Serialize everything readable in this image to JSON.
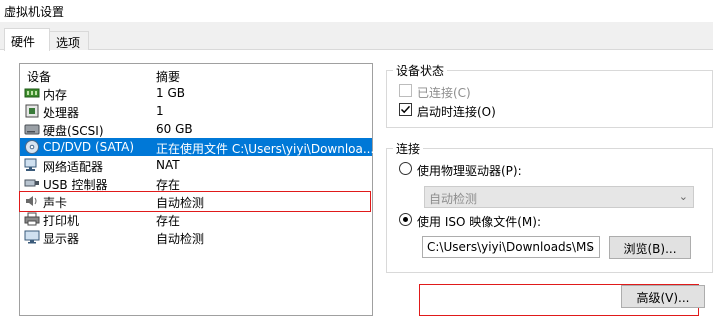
{
  "window": {
    "title": "虚拟机设置"
  },
  "tabs": [
    {
      "label": "硬件",
      "active": true
    },
    {
      "label": "选项",
      "active": false
    }
  ],
  "device_list": {
    "headers": {
      "device": "设备",
      "summary": "摘要"
    },
    "rows": [
      {
        "name": "内存",
        "summary": "1 GB",
        "icon": "memory-icon",
        "selected": false
      },
      {
        "name": "处理器",
        "summary": "1",
        "icon": "processor-icon",
        "selected": false
      },
      {
        "name": "硬盘(SCSI)",
        "summary": "60 GB",
        "icon": "hard-disk-icon",
        "selected": false
      },
      {
        "name": "CD/DVD (SATA)",
        "summary": "正在使用文件 C:\\Users\\yiyi\\Downloa...",
        "icon": "cd-dvd-icon",
        "selected": true
      },
      {
        "name": "网络适配器",
        "summary": "NAT",
        "icon": "network-adapter-icon",
        "selected": false
      },
      {
        "name": "USB 控制器",
        "summary": "存在",
        "icon": "usb-icon",
        "selected": false
      },
      {
        "name": "声卡",
        "summary": "自动检测",
        "icon": "sound-card-icon",
        "selected": false
      },
      {
        "name": "打印机",
        "summary": "存在",
        "icon": "printer-icon",
        "selected": false
      },
      {
        "name": "显示器",
        "summary": "自动检测",
        "icon": "display-icon",
        "selected": false
      }
    ]
  },
  "device_status": {
    "label": "设备状态",
    "connected": {
      "label": "已连接(C)",
      "checked": false,
      "enabled": false
    },
    "connect_at_power_on": {
      "label": "启动时连接(O)",
      "checked": true,
      "enabled": true
    }
  },
  "connection": {
    "label": "连接",
    "physical_drive": {
      "label": "使用物理驱动器(P):",
      "selected": false
    },
    "physical_drive_select": {
      "value": "自动检测",
      "enabled": false
    },
    "iso_image": {
      "label": "使用 ISO 映像文件(M):",
      "selected": true
    },
    "iso_path": {
      "value": "C:\\Users\\yiyi\\Downloads\\MS"
    },
    "browse_button": "浏览(B)...",
    "advanced_button": "高级(V)..."
  },
  "colors": {
    "selection": "#0078d7",
    "highlight_outline": "#e01a1a"
  }
}
